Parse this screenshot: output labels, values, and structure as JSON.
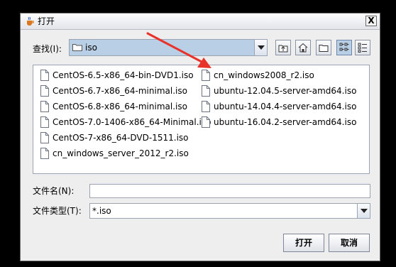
{
  "window": {
    "title": "打开",
    "close_glyph": "X"
  },
  "lookin": {
    "label": "查找(I):",
    "value": "iso"
  },
  "files": [
    "CentOS-6.5-x86_64-bin-DVD1.iso",
    "CentOS-6.7-x86_64-minimal.iso",
    "CentOS-6.8-x86_64-minimal.iso",
    "CentOS-7.0-1406-x86_64-Minimal.iso",
    "CentOS-7-x86_64-DVD-1511.iso",
    "cn_windows_server_2012_r2.iso",
    "cn_windows2008_r2.iso",
    "ubuntu-12.04.5-server-amd64.iso",
    "ubuntu-14.04.4-server-amd64.iso",
    "ubuntu-16.04.2-server-amd64.iso"
  ],
  "filename": {
    "label": "文件名(N):",
    "value": ""
  },
  "filetype": {
    "label": "文件类型(T):",
    "value": "*.iso"
  },
  "buttons": {
    "open": "打开",
    "cancel": "取消"
  },
  "toolbar_icons": [
    "up-one-level-icon",
    "home-icon",
    "new-folder-icon",
    "list-view-icon",
    "details-view-icon"
  ],
  "colors": {
    "selection": "#b8cfe5",
    "annotation_arrow": "#e8322a"
  }
}
